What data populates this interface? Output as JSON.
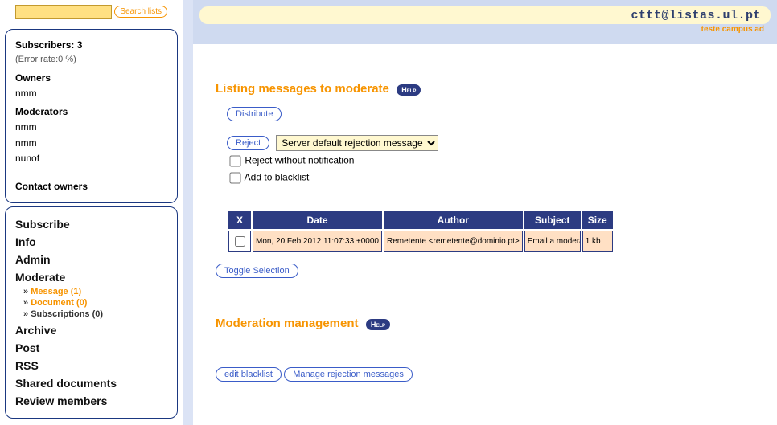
{
  "search": {
    "placeholder": "",
    "button": "Search lists"
  },
  "sidebar_info": {
    "subscribers_label": "Subscribers: 3",
    "error_rate": "(Error rate:0 %)",
    "owners_label": "Owners",
    "owners": [
      "nmm"
    ],
    "moderators_label": "Moderators",
    "moderators": [
      "nmm",
      "nmm",
      "nunof"
    ],
    "contact": "Contact owners"
  },
  "nav": {
    "subscribe": "Subscribe",
    "info": "Info",
    "admin": "Admin",
    "moderate": "Moderate",
    "mod_sub": {
      "message": "Message (1)",
      "document": "Document (0)",
      "subscriptions": "Subscriptions (0)"
    },
    "archive": "Archive",
    "post": "Post",
    "rss": "RSS",
    "shared": "Shared documents",
    "review": "Review members"
  },
  "banner": {
    "title": "cttt@listas.ul.pt",
    "sub": "teste campus ad"
  },
  "mod": {
    "title": "Listing messages to moderate",
    "help": "Help",
    "distribute": "Distribute",
    "reject": "Reject",
    "reject_select": "Server default rejection message",
    "reject_no_notif": "Reject without notification",
    "add_blacklist": "Add to blacklist",
    "toggle": "Toggle Selection"
  },
  "table": {
    "h_x": "X",
    "h_date": "Date",
    "h_author": "Author",
    "h_subject": "Subject",
    "h_size": "Size",
    "rows": [
      {
        "date": "Mon, 20 Feb 2012 11:07:33 +0000",
        "author": "Remetente <remetente@dominio.pt>",
        "subject": "Email a moderar",
        "size": "1 kb"
      }
    ]
  },
  "mgmt": {
    "title": "Moderation management",
    "help": "Help",
    "edit_blacklist": "edit blacklist",
    "manage_reject": "Manage rejection messages"
  }
}
